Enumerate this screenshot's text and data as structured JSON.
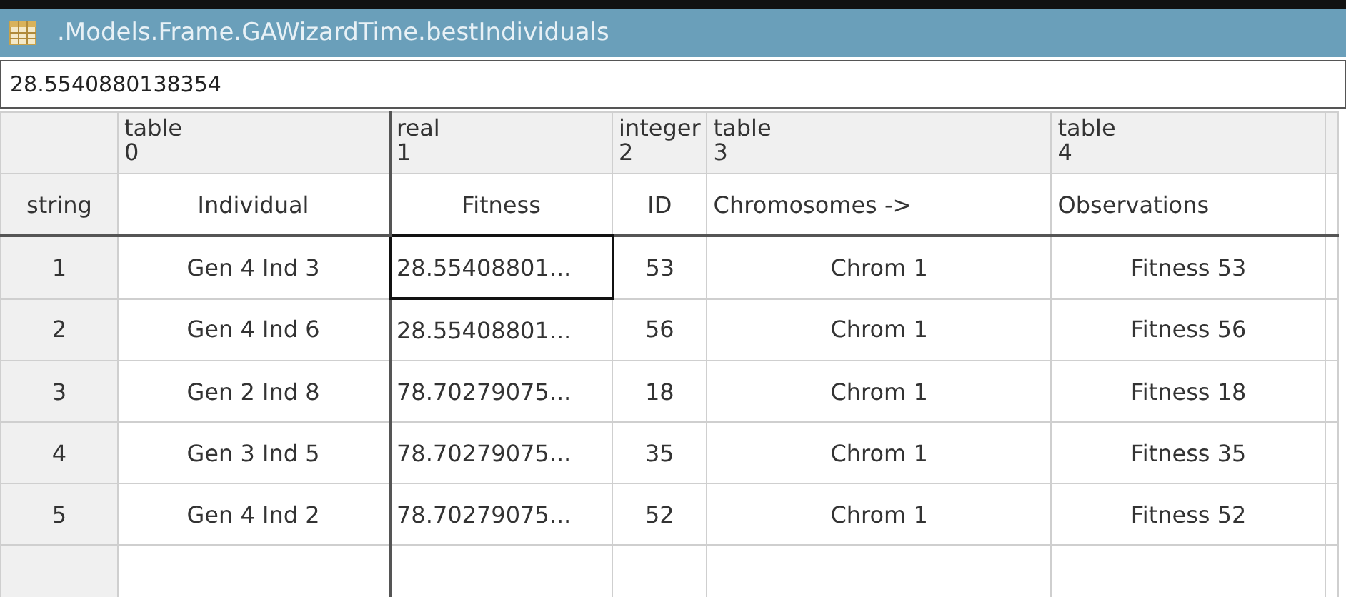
{
  "window": {
    "title": ".Models.Frame.GAWizardTime.bestIndividuals"
  },
  "value_field": {
    "value": "28.5540880138354"
  },
  "table": {
    "row_header_label": "string",
    "columns": [
      {
        "type": "table",
        "index": "0",
        "name": "Individual"
      },
      {
        "type": "real",
        "index": "1",
        "name": "Fitness"
      },
      {
        "type": "integer",
        "index": "2",
        "name": "ID"
      },
      {
        "type": "table",
        "index": "3",
        "name": "Chromosomes ->"
      },
      {
        "type": "table",
        "index": "4",
        "name": "Observations"
      }
    ],
    "rows": [
      {
        "number": "1",
        "cells": [
          {
            "text": "Gen 4 Ind 3",
            "selected": false
          },
          {
            "text": "28.55408801...",
            "selected": true
          },
          {
            "text": "53",
            "selected": false
          },
          {
            "text": "Chrom 1",
            "selected": false
          },
          {
            "text": "Fitness 53",
            "selected": false
          }
        ]
      },
      {
        "number": "2",
        "cells": [
          {
            "text": "Gen 4 Ind 6",
            "selected": false
          },
          {
            "text": "28.55408801...",
            "selected": false
          },
          {
            "text": "56",
            "selected": false
          },
          {
            "text": "Chrom 1",
            "selected": false
          },
          {
            "text": "Fitness 56",
            "selected": false
          }
        ]
      },
      {
        "number": "3",
        "cells": [
          {
            "text": "Gen 2 Ind 8",
            "selected": false
          },
          {
            "text": "78.70279075...",
            "selected": false
          },
          {
            "text": "18",
            "selected": false
          },
          {
            "text": "Chrom 1",
            "selected": false
          },
          {
            "text": "Fitness 18",
            "selected": false
          }
        ]
      },
      {
        "number": "4",
        "cells": [
          {
            "text": "Gen 3 Ind 5",
            "selected": false
          },
          {
            "text": "78.70279075...",
            "selected": false
          },
          {
            "text": "35",
            "selected": false
          },
          {
            "text": "Chrom 1",
            "selected": false
          },
          {
            "text": "Fitness 35",
            "selected": false
          }
        ]
      },
      {
        "number": "5",
        "cells": [
          {
            "text": "Gen 4 Ind 2",
            "selected": false
          },
          {
            "text": "78.70279075...",
            "selected": false
          },
          {
            "text": "52",
            "selected": false
          },
          {
            "text": "Chrom 1",
            "selected": false
          },
          {
            "text": "Fitness 52",
            "selected": false
          }
        ]
      }
    ]
  }
}
